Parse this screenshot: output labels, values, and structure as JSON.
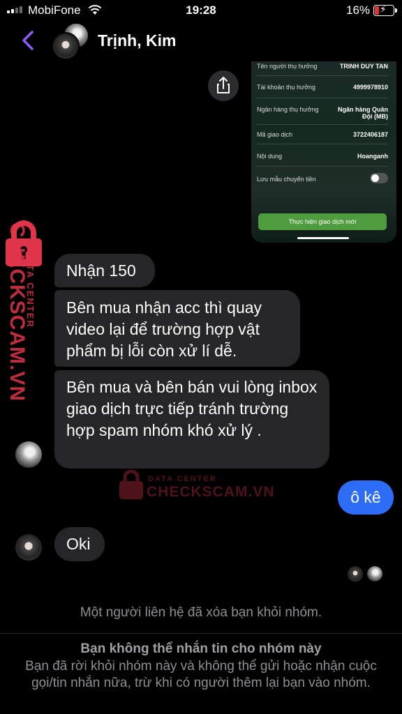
{
  "status_bar": {
    "carrier": "MobiFone",
    "time": "19:28",
    "battery": "16%",
    "battery_color": "#e5332f"
  },
  "header": {
    "title": "Trịnh, Kim",
    "back_icon": "chevron-left-icon",
    "accent": "#8e5cf7"
  },
  "transfer_screenshot": {
    "rows": [
      {
        "label": "Tên người thụ hưởng",
        "value": "TRINH DUY TAN"
      },
      {
        "label": "Tài khoản thụ hưởng",
        "value": "4999978910"
      },
      {
        "label": "Ngân hàng thụ hưởng",
        "value": "Ngân hàng Quân Đội (MB)"
      },
      {
        "label": "Mã giao dịch",
        "value": "3722406187"
      },
      {
        "label": "Nội dung",
        "value": "Hoanganh"
      }
    ],
    "save_template_label": "Lưu mẫu chuyển tiền",
    "new_transaction_button": "Thực hiện giao dịch mới"
  },
  "messages": {
    "m1": "Nhận 150",
    "m2": "Bên mua nhận acc thì quay video lại để trường hợp vật phẩm bị lỗi còn xử lí dễ.",
    "m3": "Bên mua và bên bán vui lòng inbox giao dịch trực tiếp tránh trường hợp spam nhóm khó xử lý .",
    "mine": "ô kê",
    "m4": "Oki"
  },
  "watermark": {
    "top": "DATA CENTER",
    "bottom": "CHECKSCAM.VN",
    "color": "#e0344a"
  },
  "footer": {
    "system_message": "Một người liên hệ đã xóa bạn khỏi nhóm.",
    "title": "Bạn không thể nhắn tin cho nhóm này",
    "body": "Bạn đã rời khỏi nhóm này và không thể gửi hoặc nhận cuộc gọi/tin nhắn nữa, trừ khi có người thêm lại bạn vào nhóm."
  }
}
